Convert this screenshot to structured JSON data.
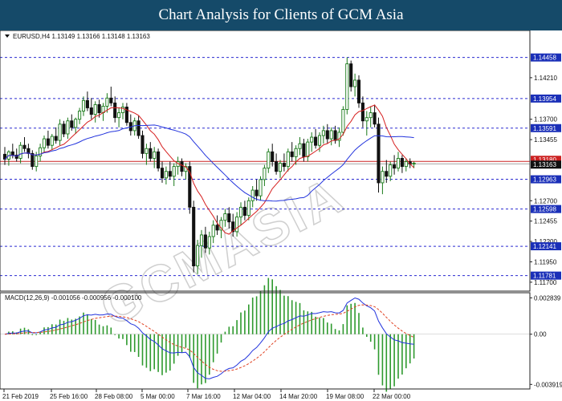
{
  "banner": {
    "title": "Chart Analysis for Clients of GCM Asia"
  },
  "colors": {
    "banner_bg": "#154a69",
    "bull": "#1a7a1a",
    "bear": "#111111",
    "ma_fast": "#d62020",
    "ma_slow": "#2233dd",
    "level_line": "#2a2ad0",
    "price_line": "#cc2222",
    "macd_hist": "#2e9a2e",
    "macd_signal": "#e04020",
    "axis_label_bg": "#1a2fb8",
    "price_label_bg": "#111111"
  },
  "watermark": "GCMASIA",
  "chart_data": [
    {
      "type": "candlestick",
      "symbol_line": "EURUSD,H4  1.13149 1.13166 1.13148 1.13163",
      "ylim": [
        1.1162,
        1.1476
      ],
      "y_ticks": [
        1.1421,
        1.137,
        1.1345,
        1.127,
        1.1245,
        1.122,
        1.1195,
        1.117
      ],
      "y_tick_labels": [
        "1.14210",
        "1.13700",
        "1.13455",
        "1.12700",
        "1.12455",
        "1.12200",
        "1.11950",
        "1.11700"
      ],
      "horizontal_levels": [
        1.14458,
        1.13954,
        1.13591,
        1.12963,
        1.12598,
        1.12141,
        1.11781
      ],
      "level_labels": [
        "1.14458",
        "1.13954",
        "1.13591",
        "1.12963",
        "1.12598",
        "1.12141",
        "1.11781"
      ],
      "current_price": 1.13163,
      "current_price_label": "1.13163",
      "hidden_tag_label": "1.13180",
      "x_labels": [
        "21 Feb 2019",
        "25 Feb 16:00",
        "28 Feb 08:00",
        "5 Mar 00:00",
        "7 Mar 16:00",
        "12 Mar 04:00",
        "14 Mar 20:00",
        "19 Mar 08:00",
        "22 Mar 00:00"
      ],
      "ohlc": [
        [
          1.1327,
          1.1336,
          1.1314,
          1.1321
        ],
        [
          1.1321,
          1.1332,
          1.1313,
          1.133
        ],
        [
          1.133,
          1.134,
          1.1322,
          1.1326
        ],
        [
          1.1326,
          1.1334,
          1.1318,
          1.1322
        ],
        [
          1.1322,
          1.1342,
          1.1316,
          1.1338
        ],
        [
          1.1338,
          1.1348,
          1.133,
          1.1334
        ],
        [
          1.1334,
          1.134,
          1.1322,
          1.1328
        ],
        [
          1.1328,
          1.1332,
          1.1308,
          1.1312
        ],
        [
          1.1312,
          1.133,
          1.1306,
          1.1325
        ],
        [
          1.1325,
          1.134,
          1.1318,
          1.1335
        ],
        [
          1.1335,
          1.135,
          1.1329,
          1.1346
        ],
        [
          1.1346,
          1.1356,
          1.1334,
          1.1338
        ],
        [
          1.1338,
          1.1352,
          1.1332,
          1.1349
        ],
        [
          1.1349,
          1.136,
          1.134,
          1.1344
        ],
        [
          1.1344,
          1.137,
          1.1338,
          1.1364
        ],
        [
          1.1364,
          1.1368,
          1.1348,
          1.1352
        ],
        [
          1.1352,
          1.1372,
          1.1346,
          1.1368
        ],
        [
          1.1368,
          1.1376,
          1.1356,
          1.136
        ],
        [
          1.136,
          1.1372,
          1.1352,
          1.137
        ],
        [
          1.137,
          1.1384,
          1.1364,
          1.138
        ],
        [
          1.138,
          1.1398,
          1.1374,
          1.1393
        ],
        [
          1.1393,
          1.1404,
          1.138,
          1.1384
        ],
        [
          1.1384,
          1.1396,
          1.137,
          1.1376
        ],
        [
          1.1376,
          1.1392,
          1.1366,
          1.1388
        ],
        [
          1.1388,
          1.1394,
          1.1372,
          1.1378
        ],
        [
          1.1378,
          1.139,
          1.1368,
          1.1386
        ],
        [
          1.1386,
          1.1402,
          1.1378,
          1.1396
        ],
        [
          1.1396,
          1.141,
          1.1386,
          1.139
        ],
        [
          1.139,
          1.1398,
          1.1366,
          1.1372
        ],
        [
          1.1372,
          1.1384,
          1.136,
          1.1378
        ],
        [
          1.1378,
          1.139,
          1.137,
          1.1385
        ],
        [
          1.1385,
          1.139,
          1.1362,
          1.1366
        ],
        [
          1.1366,
          1.1376,
          1.135,
          1.1356
        ],
        [
          1.1356,
          1.1372,
          1.135,
          1.1368
        ],
        [
          1.1368,
          1.1374,
          1.1346,
          1.135
        ],
        [
          1.135,
          1.1356,
          1.1322,
          1.1328
        ],
        [
          1.1328,
          1.134,
          1.1314,
          1.1334
        ],
        [
          1.1334,
          1.1342,
          1.1318,
          1.1322
        ],
        [
          1.1322,
          1.1336,
          1.131,
          1.133
        ],
        [
          1.133,
          1.1334,
          1.1306,
          1.131
        ],
        [
          1.131,
          1.1318,
          1.1292,
          1.1298
        ],
        [
          1.1298,
          1.1312,
          1.129,
          1.1306
        ],
        [
          1.1306,
          1.1318,
          1.1296,
          1.13
        ],
        [
          1.13,
          1.1316,
          1.1288,
          1.1312
        ],
        [
          1.1312,
          1.1324,
          1.1302,
          1.1318
        ],
        [
          1.1318,
          1.1322,
          1.13,
          1.1306
        ],
        [
          1.1306,
          1.1316,
          1.1296,
          1.1312
        ],
        [
          1.1312,
          1.1318,
          1.1254,
          1.1262
        ],
        [
          1.1262,
          1.127,
          1.1182,
          1.119
        ],
        [
          1.119,
          1.1222,
          1.118,
          1.1215
        ],
        [
          1.1215,
          1.1234,
          1.12,
          1.1228
        ],
        [
          1.1228,
          1.1238,
          1.1206,
          1.1212
        ],
        [
          1.1212,
          1.1232,
          1.1204,
          1.1226
        ],
        [
          1.1226,
          1.1246,
          1.1218,
          1.124
        ],
        [
          1.124,
          1.1252,
          1.1228,
          1.1234
        ],
        [
          1.1234,
          1.125,
          1.1224,
          1.1246
        ],
        [
          1.1246,
          1.126,
          1.1238,
          1.1254
        ],
        [
          1.1254,
          1.1262,
          1.1236,
          1.1244
        ],
        [
          1.1244,
          1.1254,
          1.1226,
          1.1232
        ],
        [
          1.1232,
          1.1256,
          1.1226,
          1.125
        ],
        [
          1.125,
          1.1268,
          1.124,
          1.1262
        ],
        [
          1.1262,
          1.127,
          1.1246,
          1.1252
        ],
        [
          1.1252,
          1.1274,
          1.1246,
          1.127
        ],
        [
          1.127,
          1.1288,
          1.1262,
          1.1283
        ],
        [
          1.1283,
          1.1296,
          1.127,
          1.1276
        ],
        [
          1.1276,
          1.13,
          1.127,
          1.1296
        ],
        [
          1.1296,
          1.1314,
          1.1288,
          1.131
        ],
        [
          1.131,
          1.1334,
          1.1304,
          1.133
        ],
        [
          1.133,
          1.134,
          1.1312,
          1.1318
        ],
        [
          1.1318,
          1.1328,
          1.1302,
          1.1306
        ],
        [
          1.1306,
          1.132,
          1.1298,
          1.1316
        ],
        [
          1.1316,
          1.1328,
          1.1306,
          1.1312
        ],
        [
          1.1312,
          1.1334,
          1.1306,
          1.133
        ],
        [
          1.133,
          1.1342,
          1.1318,
          1.1324
        ],
        [
          1.1324,
          1.1338,
          1.1314,
          1.1334
        ],
        [
          1.1334,
          1.1348,
          1.1326,
          1.134
        ],
        [
          1.134,
          1.1346,
          1.1318,
          1.1324
        ],
        [
          1.1324,
          1.1346,
          1.1318,
          1.1342
        ],
        [
          1.1342,
          1.1354,
          1.133,
          1.1348
        ],
        [
          1.1348,
          1.1358,
          1.1334,
          1.1338
        ],
        [
          1.1338,
          1.1354,
          1.133,
          1.135
        ],
        [
          1.135,
          1.1362,
          1.134,
          1.1356
        ],
        [
          1.1356,
          1.1364,
          1.134,
          1.1346
        ],
        [
          1.1346,
          1.136,
          1.1338,
          1.1356
        ],
        [
          1.1356,
          1.1362,
          1.134,
          1.1344
        ],
        [
          1.1344,
          1.136,
          1.1336,
          1.1354
        ],
        [
          1.1354,
          1.1386,
          1.135,
          1.1382
        ],
        [
          1.1382,
          1.1446,
          1.1376,
          1.1438
        ],
        [
          1.1438,
          1.1442,
          1.1404,
          1.141
        ],
        [
          1.141,
          1.1426,
          1.1398,
          1.1418
        ],
        [
          1.1418,
          1.1424,
          1.1384,
          1.139
        ],
        [
          1.139,
          1.1398,
          1.136,
          1.1368
        ],
        [
          1.1368,
          1.138,
          1.135,
          1.1372
        ],
        [
          1.1372,
          1.1386,
          1.136,
          1.1378
        ],
        [
          1.1378,
          1.1388,
          1.136,
          1.1364
        ],
        [
          1.1364,
          1.1372,
          1.128,
          1.1292
        ],
        [
          1.1292,
          1.1312,
          1.1278,
          1.1306
        ],
        [
          1.1306,
          1.132,
          1.1292,
          1.13
        ],
        [
          1.13,
          1.1318,
          1.1294,
          1.1314
        ],
        [
          1.1314,
          1.1326,
          1.1302,
          1.131
        ],
        [
          1.131,
          1.133,
          1.1306,
          1.1322
        ],
        [
          1.1322,
          1.1326,
          1.1304,
          1.1312
        ],
        [
          1.1312,
          1.1322,
          1.1306,
          1.1318
        ],
        [
          1.1318,
          1.1322,
          1.131,
          1.1315
        ],
        [
          1.1315,
          1.1318,
          1.131,
          1.1316
        ]
      ]
    },
    {
      "type": "macd",
      "label": "MACD(12,26,9) -0.001056 -0.000956 -0.000100",
      "ylim": [
        -0.00415,
        0.00305
      ],
      "y_ticks": [
        0.002839,
        0.0,
        -0.003919
      ],
      "y_tick_labels": [
        "0.002839",
        "0.00",
        "-0.003919"
      ]
    }
  ]
}
